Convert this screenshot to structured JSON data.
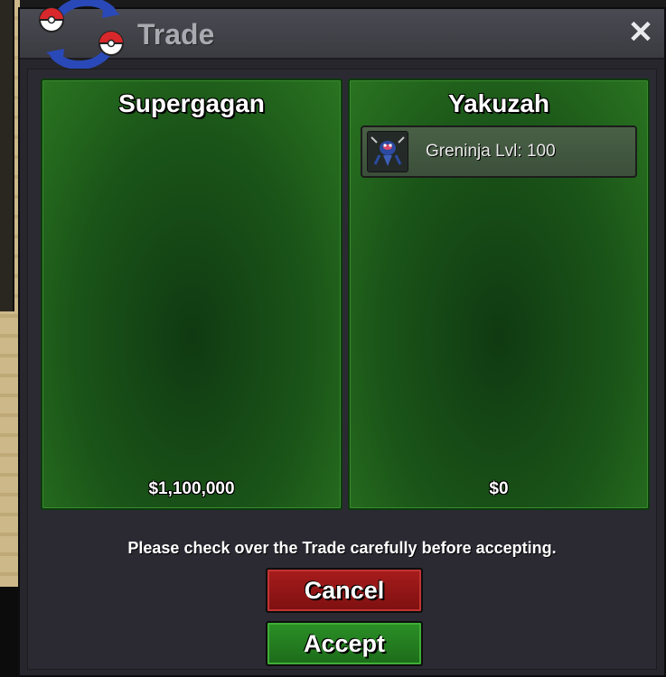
{
  "window": {
    "title": "Trade",
    "close_symbol": "✕",
    "icon": "trade-swap-icon"
  },
  "left_panel": {
    "player_name": "Supergagan",
    "money": "$1,100,000",
    "items": []
  },
  "right_panel": {
    "player_name": "Yakuzah",
    "money": "$0",
    "items": [
      {
        "label": "Greninja  Lvl: 100",
        "icon": "greninja-icon"
      }
    ]
  },
  "notice": "Please check over the Trade carefully before accepting.",
  "buttons": {
    "cancel_label": "Cancel",
    "accept_label": "Accept"
  },
  "colors": {
    "panel_green": "#1a5418",
    "cancel_red": "#a81c1c",
    "accept_green": "#2b9026"
  }
}
